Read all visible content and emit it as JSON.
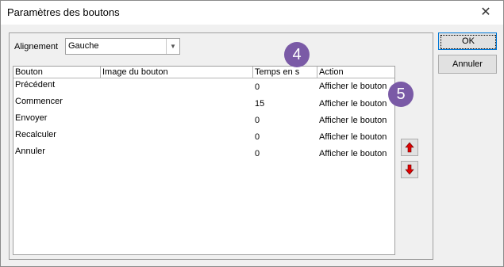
{
  "window": {
    "title": "Paramètres des boutons"
  },
  "alignment": {
    "label": "Alignement",
    "value": "Gauche"
  },
  "grid": {
    "columns": [
      "Bouton",
      "Image du bouton",
      "Temps en s",
      "Action"
    ],
    "rows": [
      {
        "bouton": "Précédent",
        "image": "",
        "temps": "0",
        "action": "Afficher le bouton"
      },
      {
        "bouton": "Commencer",
        "image": "",
        "temps": "15",
        "action": "Afficher le bouton"
      },
      {
        "bouton": "Envoyer",
        "image": "",
        "temps": "0",
        "action": "Afficher le bouton"
      },
      {
        "bouton": "Recalculer",
        "image": "",
        "temps": "0",
        "action": "Afficher le bouton"
      },
      {
        "bouton": "Annuler",
        "image": "",
        "temps": "0",
        "action": "Afficher le bouton"
      }
    ]
  },
  "buttons": {
    "ok": "OK",
    "cancel": "Annuler"
  },
  "badges": [
    "4",
    "5"
  ],
  "colors": {
    "badge": "#7a5aa6",
    "arrow": "#e00000"
  }
}
